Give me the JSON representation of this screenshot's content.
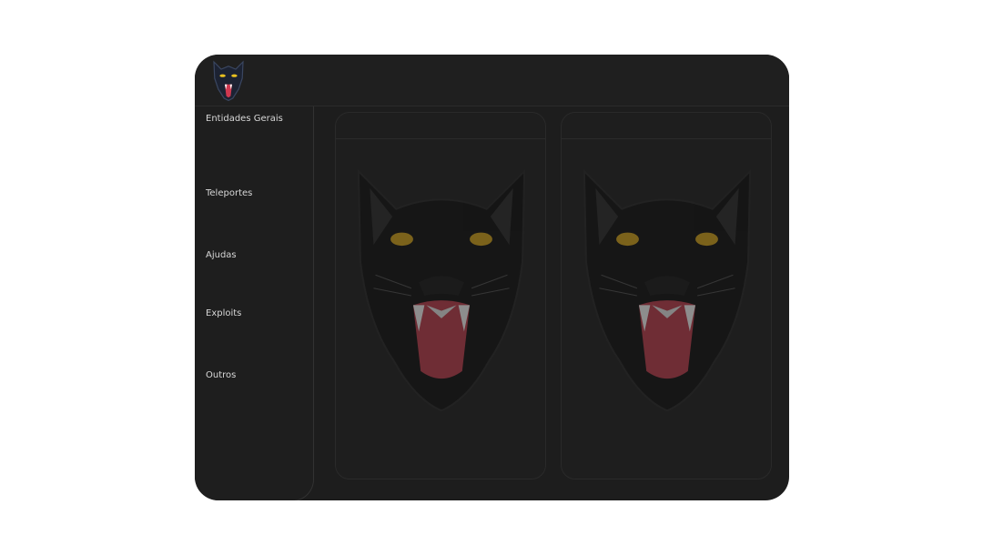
{
  "sidebar": {
    "items": [
      {
        "label": "Entidades Gerais"
      },
      {
        "label": "Teleportes"
      },
      {
        "label": "Ajudas"
      },
      {
        "label": "Exploits"
      },
      {
        "label": "Outros"
      }
    ]
  },
  "logo": {
    "icon": "panther-head-icon"
  },
  "panels": [
    {
      "icon": "panther-head-icon"
    },
    {
      "icon": "panther-head-icon"
    }
  ],
  "colors": {
    "window_bg": "#1d1d1d",
    "text": "#d8d8d8",
    "panther_eye": "#c89a1a",
    "panther_mouth": "#b23a48"
  }
}
